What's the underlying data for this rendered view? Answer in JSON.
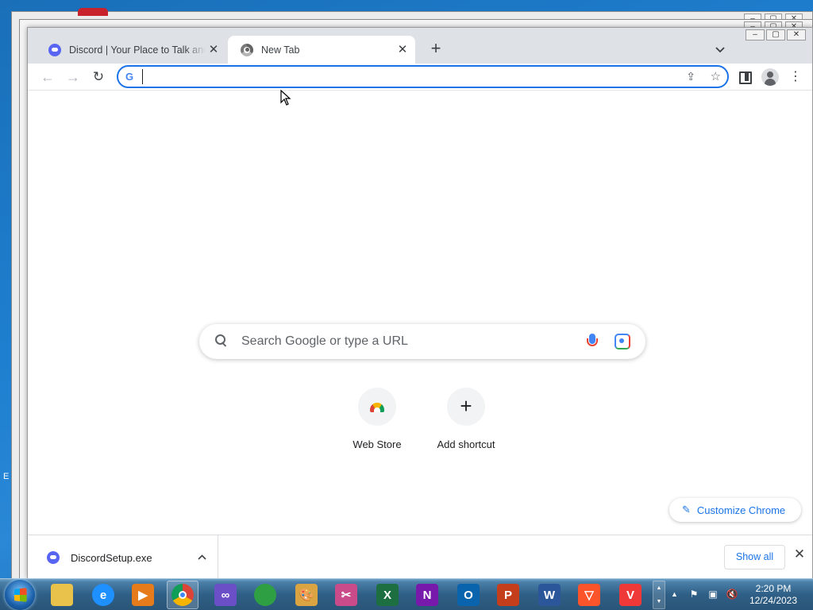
{
  "browser": {
    "tabs": [
      {
        "label": "Discord | Your Place to Talk and Hang Out",
        "icon": "discord-icon",
        "active": false
      },
      {
        "label": "New Tab",
        "icon": "chrome-icon",
        "active": true
      }
    ],
    "new_tab_symbol": "+",
    "tab_search_symbol": "⌄",
    "tab_close_symbol": "✕",
    "address_bar": {
      "value": "",
      "placeholder": "",
      "search_engine_glyph": "G"
    },
    "window_controls": [
      "–",
      "▢",
      "✕"
    ]
  },
  "toolbar": {
    "back_symbol": "←",
    "forward_symbol": "→",
    "reload_symbol": "↻",
    "share_symbol": "⇪",
    "bookmark_symbol": "☆",
    "menu_symbol": "⋮"
  },
  "ntp": {
    "search_placeholder": "Search Google or type a URL",
    "shortcuts": [
      {
        "label": "Web Store",
        "icon": "webstore-icon"
      },
      {
        "label": "Add shortcut",
        "icon": "plus-icon",
        "symbol": "+"
      }
    ],
    "customize_label": "Customize Chrome",
    "customize_icon_symbol": "✎"
  },
  "download_bar": {
    "filename": "DiscordSetup.exe",
    "chevron_symbol": "⌃",
    "show_all_label": "Show all",
    "close_symbol": "✕"
  },
  "background": {
    "left_edge_text": "E"
  },
  "taskbar": {
    "apps": [
      {
        "name": "file-explorer",
        "glyph": "",
        "color": "#e8c24a"
      },
      {
        "name": "internet-explorer",
        "glyph": "e",
        "color": "#1e90ff"
      },
      {
        "name": "media-player",
        "glyph": "▶",
        "color": "#e57b1a"
      },
      {
        "name": "chrome",
        "glyph": "",
        "color": "#db4437"
      },
      {
        "name": "visual-studio",
        "glyph": "∞",
        "color": "#6a4fc7"
      },
      {
        "name": "windows-media-center",
        "glyph": "",
        "color": "#2ea043"
      },
      {
        "name": "paint",
        "glyph": "🎨",
        "color": "#d9a441"
      },
      {
        "name": "snipping-tool",
        "glyph": "✂",
        "color": "#c94b8a"
      },
      {
        "name": "excel",
        "glyph": "X",
        "color": "#1d6f42"
      },
      {
        "name": "onenote",
        "glyph": "N",
        "color": "#7719aa"
      },
      {
        "name": "outlook",
        "glyph": "O",
        "color": "#0a64ad"
      },
      {
        "name": "powerpoint",
        "glyph": "P",
        "color": "#c43e1c"
      },
      {
        "name": "word",
        "glyph": "W",
        "color": "#2b579a"
      },
      {
        "name": "brave",
        "glyph": "▽",
        "color": "#fb542b"
      },
      {
        "name": "vivaldi",
        "glyph": "V",
        "color": "#ef3939"
      }
    ],
    "tray_up_symbol": "▲",
    "clock_time": "2:20 PM",
    "clock_date": "12/24/2023"
  }
}
